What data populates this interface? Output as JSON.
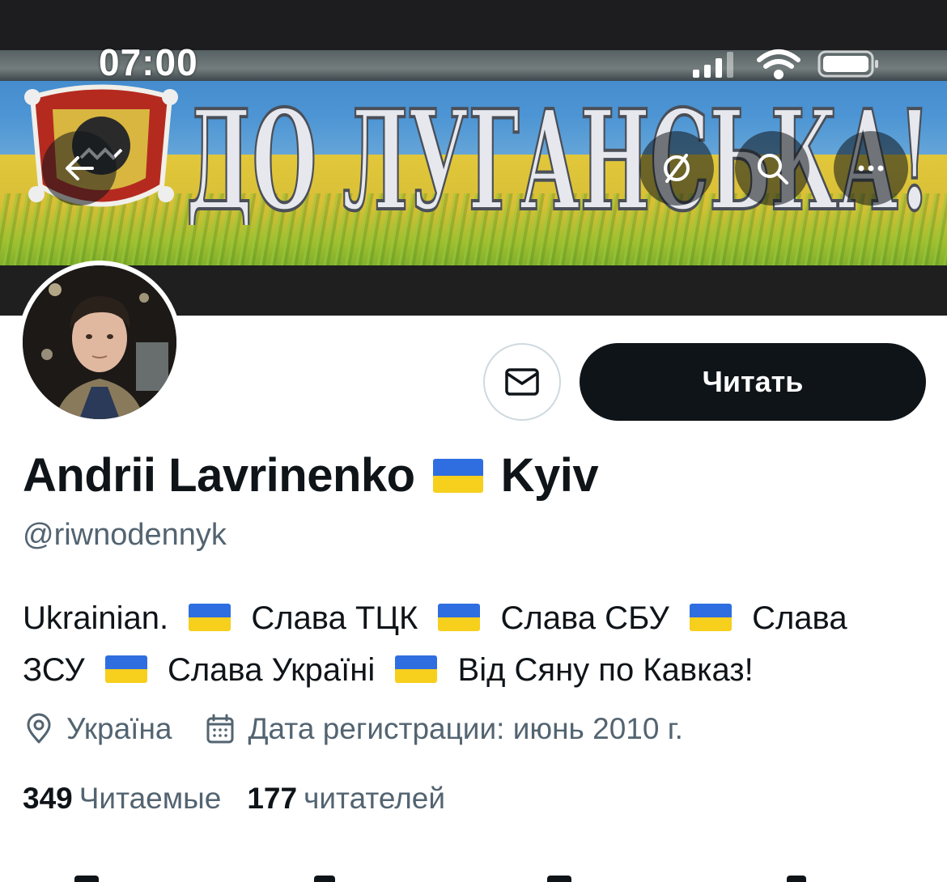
{
  "status_bar": {
    "time": "07:00"
  },
  "banner": {
    "graffiti_text": "ДО ЛУГАНСЬКА!"
  },
  "profile": {
    "name_first": "Andrii Lavrinenko",
    "name_second": "Kyiv",
    "handle": "@riwnodennyk",
    "bio": [
      "Ukrainian.",
      "Слава ТЦК",
      "Слава СБУ",
      "Слава",
      "ЗСУ",
      "Слава Україні",
      "Від Сяну по Кавказ!"
    ],
    "location": "Україна",
    "joined": "Дата регистрации: июнь 2010 г."
  },
  "actions": {
    "follow_label": "Читать"
  },
  "stats": {
    "following_count": "349",
    "following_label": "Читаемые",
    "followers_count": "177",
    "followers_label": "читателей"
  },
  "colors": {
    "text_primary": "#0f1419",
    "text_secondary": "#536471",
    "follow_button_bg": "#0f1419",
    "flag_blue": "#2f6ee0",
    "flag_yellow": "#f7cf1d"
  },
  "icons": {
    "back": "arrow-left-icon",
    "translate": "translate-icon",
    "search": "search-icon",
    "more": "more-icon",
    "message": "envelope-icon",
    "location": "location-pin-icon",
    "calendar": "calendar-icon"
  }
}
